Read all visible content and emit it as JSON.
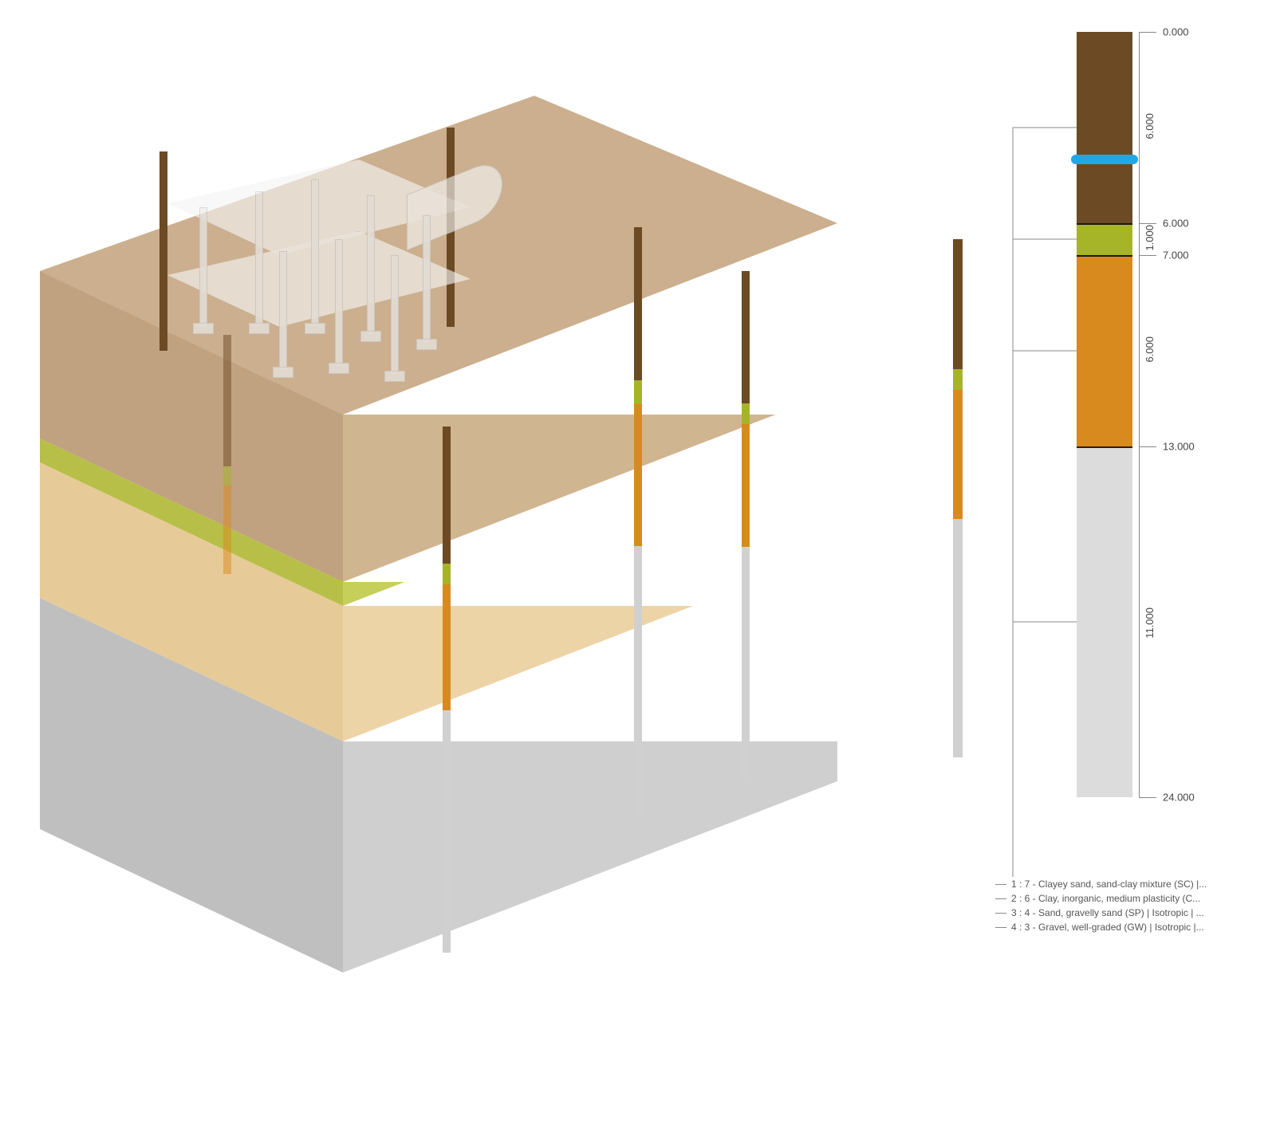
{
  "profile": {
    "total_depth": 24.0,
    "water_table_depth": 4.0,
    "depth_marks": [
      "0.000",
      "6.000",
      "7.000",
      "13.000",
      "24.000"
    ],
    "layers": [
      {
        "id": "1",
        "from": 0.0,
        "to": 6.0,
        "thickness": "6.000",
        "color": "#6b4a24",
        "legend": "1 : 7 - Clayey sand, sand-clay mixture (SC) |..."
      },
      {
        "id": "2",
        "from": 6.0,
        "to": 7.0,
        "thickness": "1.000",
        "color": "#a6b428",
        "legend": "2 : 6 - Clay, inorganic, medium plasticity (C..."
      },
      {
        "id": "3",
        "from": 7.0,
        "to": 13.0,
        "thickness": "6.000",
        "color": "#d98a1e",
        "legend": "3 : 4 - Sand, gravelly sand (SP) | Isotropic | ..."
      },
      {
        "id": "4",
        "from": 13.0,
        "to": 24.0,
        "thickness": "11.000",
        "color": "#dcdcdc",
        "legend": "4 : 3 - Gravel, well-graded (GW) | Isotropic |..."
      }
    ]
  },
  "legend": {
    "rows": [
      "1 : 7 - Clayey sand, sand-clay mixture (SC) |...",
      "2 : 6 - Clay, inorganic, medium plasticity (C...",
      "3 : 4 - Sand, gravelly sand (SP) | Isotropic | ...",
      "4 : 3 - Gravel, well-graded (GW) | Isotropic |..."
    ]
  }
}
